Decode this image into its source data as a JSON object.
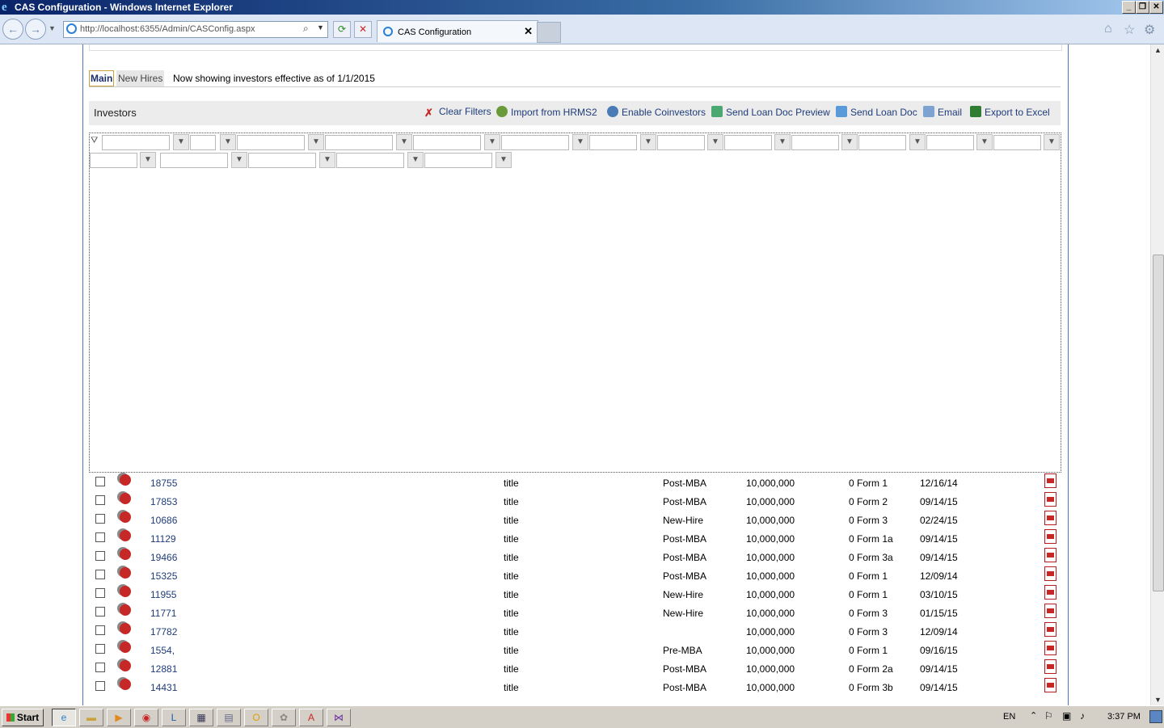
{
  "window": {
    "title": "CAS Configuration - Windows Internet Explorer",
    "url": "http://localhost:6355/Admin/CASConfig.aspx",
    "tab_label": "CAS Configuration"
  },
  "page": {
    "tabs": [
      {
        "label": "Main",
        "active": true
      },
      {
        "label": "New Hires",
        "active": false
      }
    ],
    "showing_text": "Now showing investors effective as of 1/1/2015"
  },
  "toolbar": {
    "title": "Investors",
    "actions": [
      {
        "label": "Clear Filters",
        "icon": "clear-filter-icon"
      },
      {
        "label": "Import from HRMS2",
        "icon": "import-icon"
      },
      {
        "label": "Enable Coinvestors",
        "icon": "users-icon"
      },
      {
        "label": "Send Loan Doc Preview",
        "icon": "send-preview-icon"
      },
      {
        "label": "Send Loan Doc",
        "icon": "send-doc-icon"
      },
      {
        "label": "Email",
        "icon": "email-icon"
      },
      {
        "label": "Export to Excel",
        "icon": "excel-icon"
      }
    ]
  },
  "rows": [
    {
      "id": "18755",
      "title": "title",
      "type": "Post-MBA",
      "amount": "10,000,000",
      "form": "0 Form 1",
      "date": "12/16/14"
    },
    {
      "id": "17853",
      "title": "title",
      "type": "Post-MBA",
      "amount": "10,000,000",
      "form": "0 Form 2",
      "date": "09/14/15"
    },
    {
      "id": "10686",
      "title": "title",
      "type": "New-Hire",
      "amount": "10,000,000",
      "form": "0 Form 3",
      "date": "02/24/15"
    },
    {
      "id": "11129",
      "title": "title",
      "type": "Post-MBA",
      "amount": "10,000,000",
      "form": "0 Form 1a",
      "date": "09/14/15"
    },
    {
      "id": "19466",
      "title": "title",
      "type": "Post-MBA",
      "amount": "10,000,000",
      "form": "0 Form 3a",
      "date": "09/14/15"
    },
    {
      "id": "15325",
      "title": "title",
      "type": "Post-MBA",
      "amount": "10,000,000",
      "form": "0 Form 1",
      "date": "12/09/14"
    },
    {
      "id": "11955",
      "title": "title",
      "type": "New-Hire",
      "amount": "10,000,000",
      "form": "0 Form 1",
      "date": "03/10/15"
    },
    {
      "id": "11771",
      "title": "title",
      "type": "New-Hire",
      "amount": "10,000,000",
      "form": "0 Form 3",
      "date": "01/15/15"
    },
    {
      "id": "17782",
      "title": "title",
      "type": "",
      "amount": "10,000,000",
      "form": "0 Form 3",
      "date": "12/09/14"
    },
    {
      "id": "1554,",
      "title": "title",
      "type": "Pre-MBA",
      "amount": "10,000,000",
      "form": "0 Form 1",
      "date": "09/16/15"
    },
    {
      "id": "12881",
      "title": "title",
      "type": "Post-MBA",
      "amount": "10,000,000",
      "form": "0 Form 2a",
      "date": "09/14/15"
    },
    {
      "id": "14431",
      "title": "title",
      "type": "Post-MBA",
      "amount": "10,000,000",
      "form": "0 Form 3b",
      "date": "09/14/15"
    }
  ],
  "taskbar": {
    "start_label": "Start",
    "language": "EN",
    "time": "3:37 PM"
  }
}
